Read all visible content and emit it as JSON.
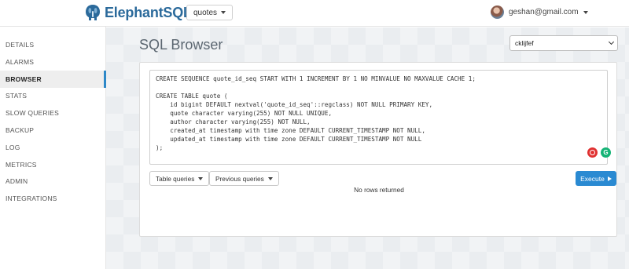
{
  "header": {
    "app_name": "ElephantSQL",
    "database": "quotes",
    "user_email": "geshan@gmail.com"
  },
  "sidebar": {
    "items": [
      {
        "label": "DETAILS",
        "active": false
      },
      {
        "label": "ALARMS",
        "active": false
      },
      {
        "label": "BROWSER",
        "active": true
      },
      {
        "label": "STATS",
        "active": false
      },
      {
        "label": "SLOW QUERIES",
        "active": false
      },
      {
        "label": "BACKUP",
        "active": false
      },
      {
        "label": "LOG",
        "active": false
      },
      {
        "label": "METRICS",
        "active": false
      },
      {
        "label": "ADMIN",
        "active": false
      },
      {
        "label": "INTEGRATIONS",
        "active": false
      }
    ]
  },
  "main": {
    "title": "SQL Browser",
    "instance": "cklijfef",
    "sql": "CREATE SEQUENCE quote_id_seq START WITH 1 INCREMENT BY 1 NO MINVALUE NO MAXVALUE CACHE 1;\n\nCREATE TABLE quote (\n    id bigint DEFAULT nextval('quote_id_seq'::regclass) NOT NULL PRIMARY KEY,\n    quote character varying(255) NOT NULL UNIQUE,\n    author character varying(255) NOT NULL,\n    created_at timestamp with time zone DEFAULT CURRENT_TIMESTAMP NOT NULL,\n    updated_at timestamp with time zone DEFAULT CURRENT_TIMESTAMP NOT NULL\n);",
    "table_queries_label": "Table queries",
    "previous_queries_label": "Previous queries",
    "execute_label": "Execute",
    "status": "No rows returned"
  },
  "colors": {
    "brand": "#2b6a9b",
    "accent": "#2a8ad2",
    "active_indicator": "#2d88c8"
  }
}
